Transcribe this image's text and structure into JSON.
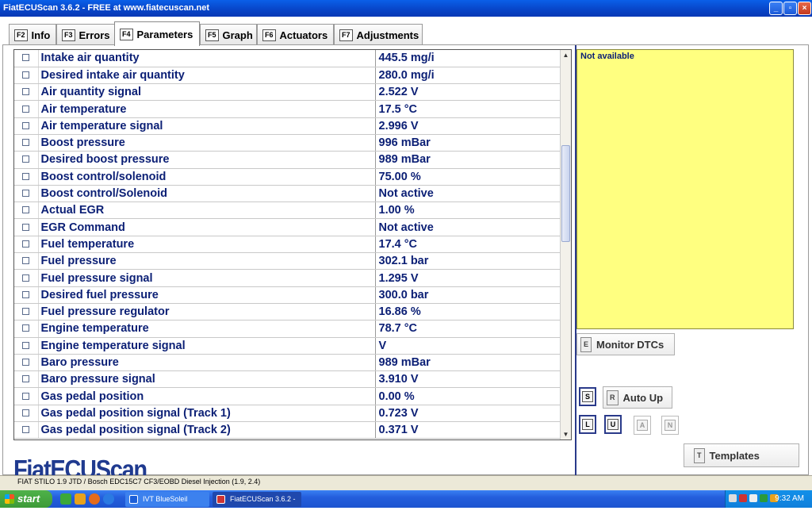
{
  "window": {
    "title": "FiatECUScan 3.6.2 - FREE at www.fiatecuscan.net"
  },
  "tabs": [
    {
      "key": "F2",
      "label": "Info"
    },
    {
      "key": "F3",
      "label": "Errors"
    },
    {
      "key": "F4",
      "label": "Parameters"
    },
    {
      "key": "F5",
      "label": "Graph"
    },
    {
      "key": "F6",
      "label": "Actuators"
    },
    {
      "key": "F7",
      "label": "Adjustments"
    }
  ],
  "active_tab": "Parameters",
  "parameters": [
    {
      "name": "Intake air quantity",
      "value": "445.5 mg/i"
    },
    {
      "name": "Desired intake air quantity",
      "value": "280.0 mg/i"
    },
    {
      "name": "Air quantity signal",
      "value": "2.522 V"
    },
    {
      "name": "Air temperature",
      "value": "17.5 °C"
    },
    {
      "name": "Air temperature signal",
      "value": "2.996 V"
    },
    {
      "name": "Boost pressure",
      "value": "996 mBar"
    },
    {
      "name": "Desired boost pressure",
      "value": "989 mBar"
    },
    {
      "name": "Boost control/solenoid",
      "value": "75.00 %"
    },
    {
      "name": "Boost control/Solenoid",
      "value": "Not active"
    },
    {
      "name": "Actual EGR",
      "value": "1.00 %"
    },
    {
      "name": "EGR Command",
      "value": "Not active"
    },
    {
      "name": "Fuel temperature",
      "value": "17.4 °C"
    },
    {
      "name": "Fuel pressure",
      "value": "302.1 bar"
    },
    {
      "name": "Fuel pressure signal",
      "value": "1.295 V"
    },
    {
      "name": "Desired fuel pressure",
      "value": "300.0 bar"
    },
    {
      "name": "Fuel pressure regulator",
      "value": "16.86 %"
    },
    {
      "name": "Engine temperature",
      "value": "78.7 °C"
    },
    {
      "name": "Engine temperature signal",
      "value": " V"
    },
    {
      "name": "Baro pressure",
      "value": "989 mBar"
    },
    {
      "name": "Baro pressure signal",
      "value": "3.910 V"
    },
    {
      "name": "Gas pedal position",
      "value": "0.00 %"
    },
    {
      "name": "Gas pedal position signal (Track 1)",
      "value": "0.723 V"
    },
    {
      "name": "Gas pedal position signal (Track 2)",
      "value": "0.371 V"
    }
  ],
  "info_panel": {
    "text": "Not available",
    "color": "#ffff80"
  },
  "buttons": {
    "monitor_dtcs": {
      "key": "E",
      "label": "Monitor DTCs"
    },
    "auto_up": {
      "key": "R",
      "label": "Auto Up"
    },
    "s": {
      "key": "S"
    },
    "l": {
      "key": "L"
    },
    "u": {
      "key": "U"
    },
    "a": {
      "key": "A"
    },
    "n": {
      "key": "N"
    },
    "templates": {
      "key": "T",
      "label": "Templates"
    }
  },
  "logo": {
    "text": "FiatECUScan",
    "color": "#1f3a8f"
  },
  "status_bar": {
    "text": "FIAT STILO 1.9 JTD / Bosch EDC15C7 CF3/EOBD Diesel Injection (1.9, 2.4)"
  },
  "taskbar": {
    "start_label": "start",
    "tasks": [
      {
        "label": "IVT BlueSoleil",
        "icon": "bluetooth-icon"
      },
      {
        "label": "FiatECUScan 3.6.2 - ...",
        "icon": "app-icon"
      }
    ],
    "clock": "9:32 AM"
  }
}
